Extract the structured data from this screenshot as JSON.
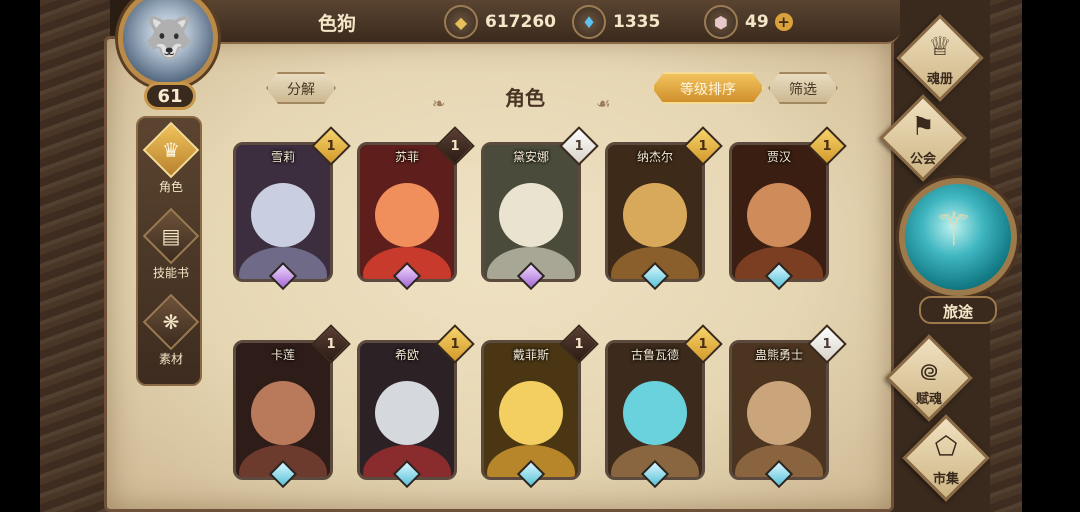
{
  "player": {
    "name": "色狗",
    "level": "61",
    "avatar_icon": "wolf-avatar"
  },
  "resources": [
    {
      "key": "gold",
      "icon": "gold-coin-icon",
      "value": "617260"
    },
    {
      "key": "gem",
      "icon": "blue-crystal-icon",
      "value": "1335"
    },
    {
      "key": "stone",
      "icon": "pink-stone-icon",
      "value": "49",
      "plus": "+"
    }
  ],
  "left_nav": [
    {
      "label": "角色",
      "icon": "helmet-icon",
      "active": true
    },
    {
      "label": "技能书",
      "icon": "book-icon",
      "active": false
    },
    {
      "label": "素材",
      "icon": "material-icon",
      "active": false
    }
  ],
  "header": {
    "decompose": "分解",
    "title": "角色",
    "sort": "等级排序",
    "filter": "筛选"
  },
  "heroes": [
    {
      "name": "雪莉",
      "badge": "1",
      "badge_style": "gold",
      "gem": "purple",
      "colors": [
        "#c9cfe0",
        "#6e6a88",
        "#3c2e3e"
      ]
    },
    {
      "name": "苏菲",
      "badge": "1",
      "badge_style": "dark",
      "gem": "purple",
      "colors": [
        "#f08e5c",
        "#c73a2c",
        "#5e1f1c"
      ]
    },
    {
      "name": "黛安娜",
      "badge": "1",
      "badge_style": "white",
      "gem": "purple",
      "colors": [
        "#e9e3cf",
        "#a8a695",
        "#4b4b3b"
      ]
    },
    {
      "name": "纳杰尔",
      "badge": "1",
      "badge_style": "gold",
      "gem": "blue",
      "colors": [
        "#d8a95a",
        "#8a5f2c",
        "#3e2a18"
      ]
    },
    {
      "name": "贾汉",
      "badge": "1",
      "badge_style": "gold",
      "gem": "blue",
      "colors": [
        "#cf8c5a",
        "#7c3e22",
        "#3a1e12"
      ]
    },
    {
      "name": "卡莲",
      "badge": "1",
      "badge_style": "dark",
      "gem": "blue",
      "colors": [
        "#b97a5c",
        "#6d3a2e",
        "#2e1c18"
      ]
    },
    {
      "name": "希欧",
      "badge": "1",
      "badge_style": "gold",
      "gem": "blue",
      "colors": [
        "#d5d8dc",
        "#8a2c2e",
        "#2c2226"
      ]
    },
    {
      "name": "戴菲斯",
      "badge": "1",
      "badge_style": "dark",
      "gem": "blue",
      "colors": [
        "#f3cf62",
        "#b8862a",
        "#4b3614"
      ]
    },
    {
      "name": "古鲁瓦德",
      "badge": "1",
      "badge_style": "gold",
      "gem": "blue",
      "colors": [
        "#6ad2dc",
        "#8a6640",
        "#3c2a1c"
      ]
    },
    {
      "name": "蛊熊勇士",
      "badge": "1",
      "badge_style": "white",
      "gem": "blue",
      "colors": [
        "#caa57c",
        "#8a643e",
        "#4b3420"
      ]
    }
  ],
  "right_menu": [
    {
      "label": "魂册",
      "icon": "soul-book-icon"
    },
    {
      "label": "公会",
      "icon": "guild-icon"
    },
    {
      "label": "旅途",
      "icon": "trident-icon"
    },
    {
      "label": "赋魂",
      "icon": "spiral-icon"
    },
    {
      "label": "市集",
      "icon": "market-icon"
    }
  ]
}
